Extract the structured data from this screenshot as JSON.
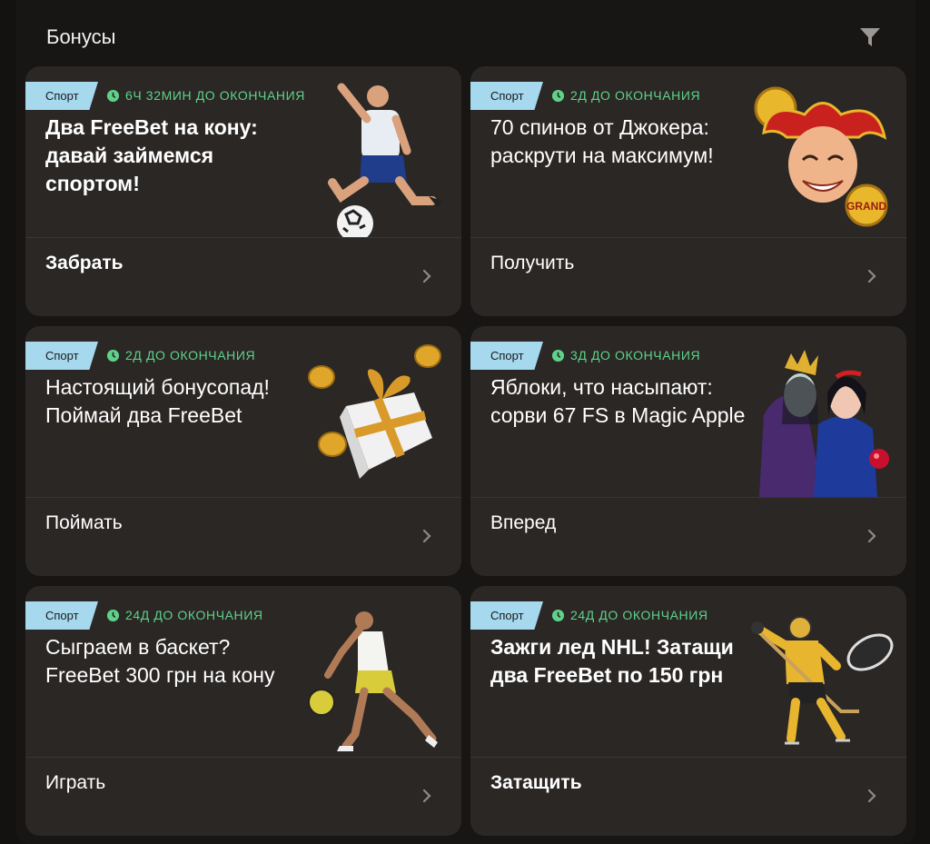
{
  "header": {
    "title": "Бонусы",
    "filter_icon": "filter-icon"
  },
  "cards": [
    {
      "tag": "Спорт",
      "timer": "6Ч 32МИН ДО ОКОНЧАНИЯ",
      "title": "Два FreeBet на кону: давай займемся спортом!",
      "action": "Забрать",
      "art": "soccer-player-image"
    },
    {
      "tag": "Спорт",
      "timer": "2Д ДО ОКОНЧАНИЯ",
      "title": "70 спинов от Джокера: раскрути на максимум!",
      "action": "Получить",
      "art": "joker-image",
      "art_label": "GRAND"
    },
    {
      "tag": "Спорт",
      "timer": "2Д ДО ОКОНЧАНИЯ",
      "title": "Настоящий бонусопад! Поймай два FreeBet",
      "action": "Поймать",
      "art": "gift-box-image"
    },
    {
      "tag": "Спорт",
      "timer": "3Д ДО ОКОНЧАНИЯ",
      "title": "Яблоки, что насыпают: сорви 67 FS в Magic Apple",
      "action": "Вперед",
      "art": "queen-and-snow-white-image"
    },
    {
      "tag": "Спорт",
      "timer": "24Д ДО ОКОНЧАНИЯ",
      "title": "Сыграем в баскет? FreeBet 300 грн на кону",
      "action": "Играть",
      "art": "basketball-player-image"
    },
    {
      "tag": "Спорт",
      "timer": "24Д ДО ОКОНЧАНИЯ",
      "title": "Зажги лед NHL! Затащи два FreeBet по 150 грн",
      "action": "Затащить",
      "art": "hockey-player-image"
    }
  ],
  "colors": {
    "tag_bg": "#a6d8ee",
    "timer": "#5fd28a",
    "card_bg": "#2a2725",
    "page_bg": "#181614"
  }
}
